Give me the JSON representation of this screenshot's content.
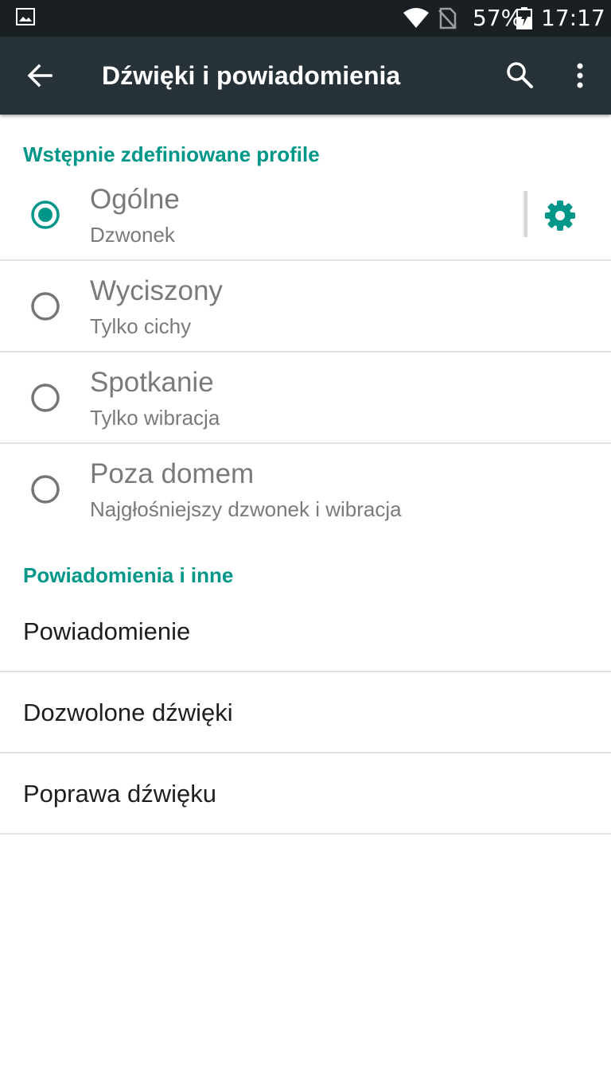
{
  "status_bar": {
    "battery": "57%",
    "time": "17:17",
    "icons": [
      "image-icon",
      "wifi-icon",
      "no-sim-icon",
      "battery-charging-icon"
    ]
  },
  "app_bar": {
    "title": "Dźwięki i powiadomienia",
    "icons": [
      "back-arrow-icon",
      "search-icon",
      "more-vert-icon"
    ],
    "color": "#263238"
  },
  "profiles_section": {
    "header": "Wstępnie zdefiniowane profile",
    "items": [
      {
        "title": "Ogólne",
        "subtitle": "Dzwonek",
        "selected": true
      },
      {
        "title": "Wyciszony",
        "subtitle": "Tylko cichy",
        "selected": false
      },
      {
        "title": "Spotkanie",
        "subtitle": "Tylko wibracja",
        "selected": false
      },
      {
        "title": "Poza domem",
        "subtitle": "Najgłośniejszy dzwonek i wibracja",
        "selected": false
      }
    ]
  },
  "notifications_section": {
    "header": "Powiadomienia i inne",
    "items": [
      {
        "label": "Powiadomienie"
      },
      {
        "label": "Dozwolone dźwięki"
      },
      {
        "label": "Poprawa dźwięku"
      }
    ]
  },
  "colors": {
    "accent": "#009688",
    "app_bar": "#263238",
    "status_bar": "#1a1f23"
  }
}
